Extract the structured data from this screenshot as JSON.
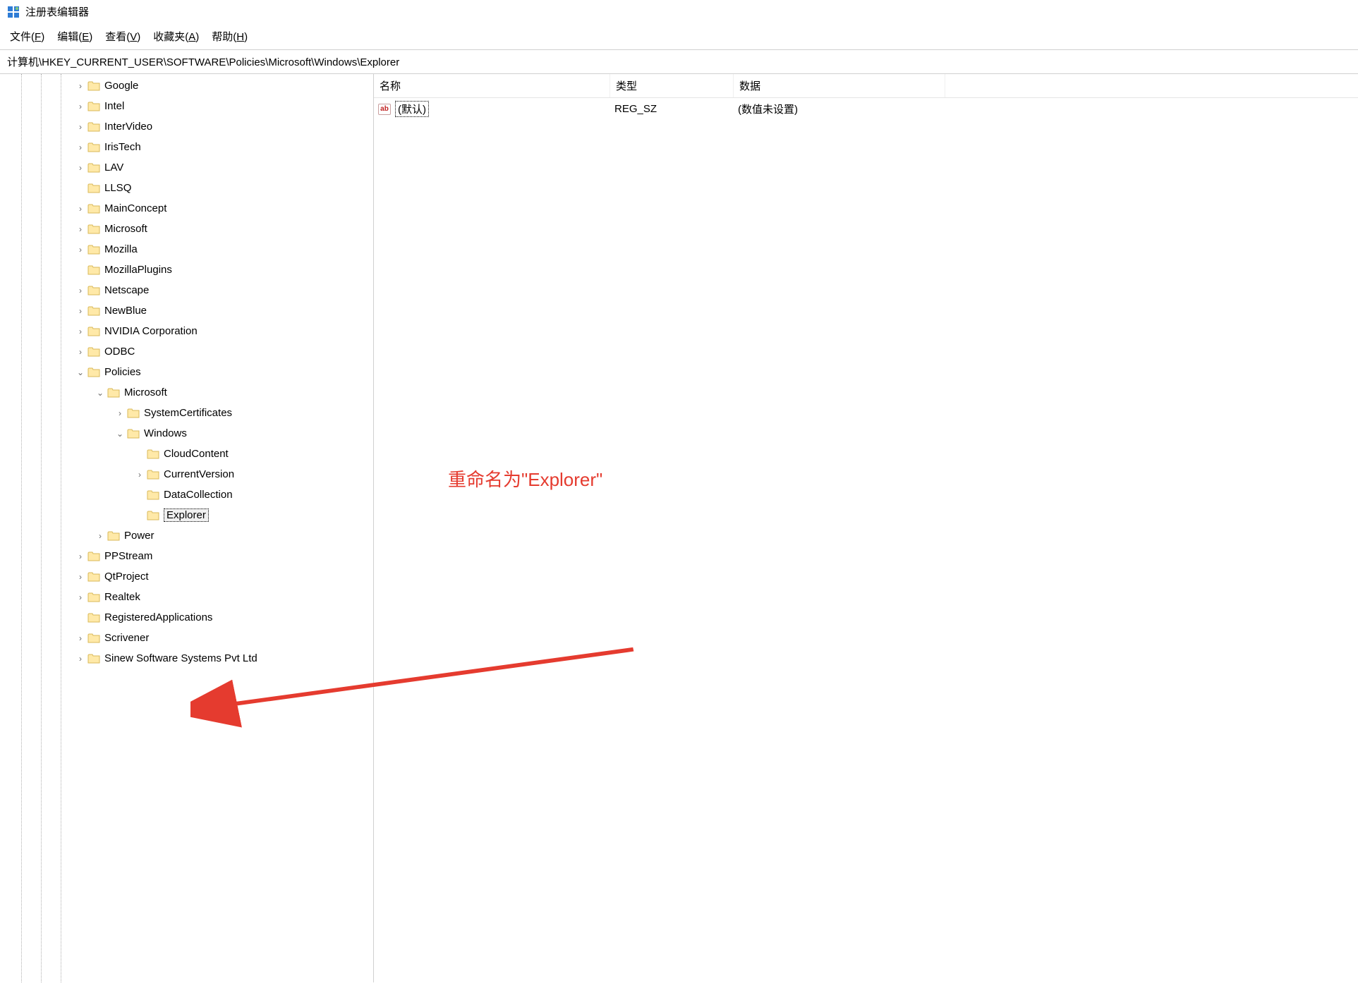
{
  "window": {
    "title": "注册表编辑器"
  },
  "menu": {
    "file": {
      "text": "文件",
      "accel": "F"
    },
    "edit": {
      "text": "编辑",
      "accel": "E"
    },
    "view": {
      "text": "查看",
      "accel": "V"
    },
    "favorites": {
      "text": "收藏夹",
      "accel": "A"
    },
    "help": {
      "text": "帮助",
      "accel": "H"
    }
  },
  "address": "计算机\\HKEY_CURRENT_USER\\SOFTWARE\\Policies\\Microsoft\\Windows\\Explorer",
  "tree": [
    {
      "depth": 2,
      "exp": "closed",
      "label": "Google"
    },
    {
      "depth": 2,
      "exp": "closed",
      "label": "Intel"
    },
    {
      "depth": 2,
      "exp": "closed",
      "label": "InterVideo"
    },
    {
      "depth": 2,
      "exp": "closed",
      "label": "IrisTech"
    },
    {
      "depth": 2,
      "exp": "closed",
      "label": "LAV"
    },
    {
      "depth": 2,
      "exp": "none",
      "label": "LLSQ"
    },
    {
      "depth": 2,
      "exp": "closed",
      "label": "MainConcept"
    },
    {
      "depth": 2,
      "exp": "closed",
      "label": "Microsoft"
    },
    {
      "depth": 2,
      "exp": "closed",
      "label": "Mozilla"
    },
    {
      "depth": 2,
      "exp": "none",
      "label": "MozillaPlugins"
    },
    {
      "depth": 2,
      "exp": "closed",
      "label": "Netscape"
    },
    {
      "depth": 2,
      "exp": "closed",
      "label": "NewBlue"
    },
    {
      "depth": 2,
      "exp": "closed",
      "label": "NVIDIA Corporation"
    },
    {
      "depth": 2,
      "exp": "closed",
      "label": "ODBC"
    },
    {
      "depth": 2,
      "exp": "open",
      "label": "Policies"
    },
    {
      "depth": 3,
      "exp": "open",
      "label": "Microsoft"
    },
    {
      "depth": 4,
      "exp": "closed",
      "label": "SystemCertificates"
    },
    {
      "depth": 4,
      "exp": "open",
      "label": "Windows"
    },
    {
      "depth": 5,
      "exp": "none",
      "label": "CloudContent"
    },
    {
      "depth": 5,
      "exp": "closed",
      "label": "CurrentVersion"
    },
    {
      "depth": 5,
      "exp": "none",
      "label": "DataCollection"
    },
    {
      "depth": 5,
      "exp": "none",
      "label": "Explorer",
      "boxed": true
    },
    {
      "depth": 3,
      "exp": "closed",
      "label": "Power"
    },
    {
      "depth": 2,
      "exp": "closed",
      "label": "PPStream"
    },
    {
      "depth": 2,
      "exp": "closed",
      "label": "QtProject"
    },
    {
      "depth": 2,
      "exp": "closed",
      "label": "Realtek"
    },
    {
      "depth": 2,
      "exp": "none",
      "label": "RegisteredApplications"
    },
    {
      "depth": 2,
      "exp": "closed",
      "label": "Scrivener"
    },
    {
      "depth": 2,
      "exp": "closed",
      "label": "Sinew Software Systems Pvt Ltd"
    }
  ],
  "list": {
    "columns": {
      "name": "名称",
      "type": "类型",
      "data": "数据"
    },
    "col_widths": {
      "name": 335,
      "type": 175,
      "data": 300
    },
    "rows": [
      {
        "icon": "ab",
        "name": "(默认)",
        "type": "REG_SZ",
        "data": "(数值未设置)"
      }
    ]
  },
  "annotation": {
    "text": "重命名为\"Explorer\""
  }
}
